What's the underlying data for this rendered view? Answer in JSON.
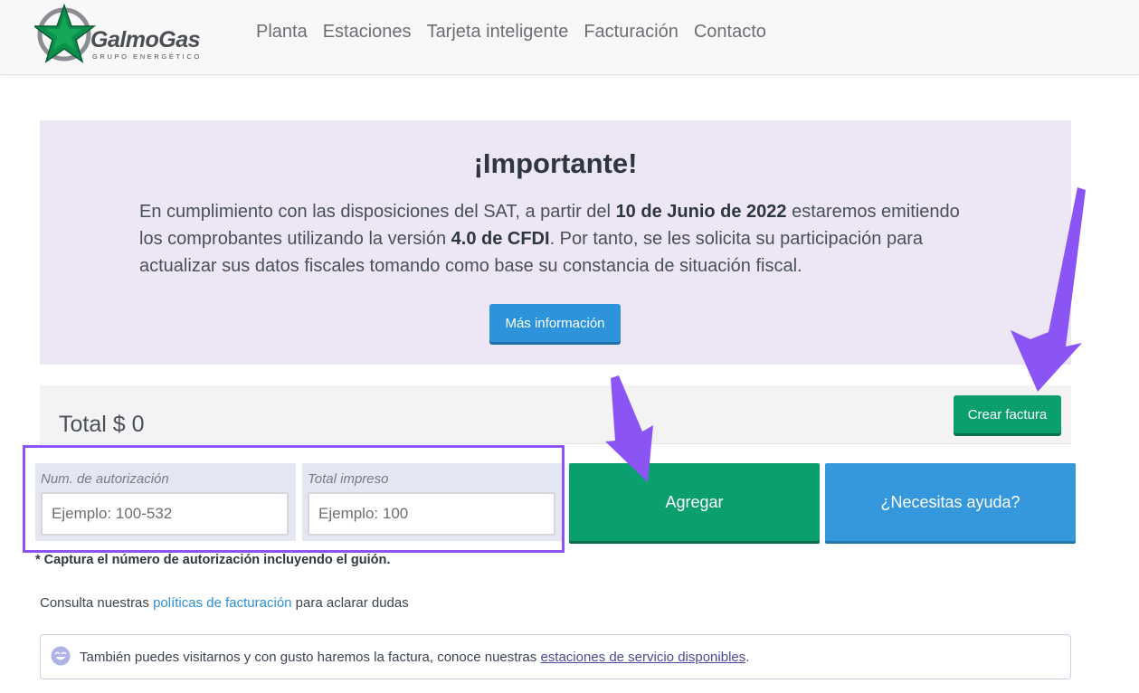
{
  "brand": {
    "name": "GalmoGas",
    "tagline": "GRUPO ENERGÉTICO",
    "colors": {
      "star": "#0c8f4b",
      "text": "#4a4e52"
    }
  },
  "nav": {
    "items": [
      "Planta",
      "Estaciones",
      "Tarjeta inteligente",
      "Facturación",
      "Contacto"
    ]
  },
  "notice": {
    "title": "¡Importante!",
    "text_1": "En cumplimiento con las disposiciones del SAT, a partir del ",
    "date": "10 de Junio de 2022",
    "text_2": " estaremos emitiendo los comprobantes utilizando la versión ",
    "version": "4.0 de CFDI",
    "text_3": ". Por tanto, se les solicita su participación para actualizar sus datos fiscales tomando como base su constancia de situación fiscal.",
    "button_label": "Más información",
    "background": "#ece6f5"
  },
  "invoice": {
    "total_label": "Total $ 0",
    "create_button": "Crear factura"
  },
  "form": {
    "auth_label": "Num. de autorización",
    "auth_placeholder": "Ejemplo: 100-532",
    "total_label": "Total impreso",
    "total_placeholder": "Ejemplo: 100",
    "add_button": "Agregar",
    "help_button": "¿Necesitas ayuda?",
    "note": "* Captura el número de autorización incluyendo el guión."
  },
  "policies": {
    "prefix": "Consulta nuestras ",
    "link": "políticas de facturación",
    "suffix": " para aclarar dudas"
  },
  "visit": {
    "icon": "smile-icon",
    "text": "También puedes visitarnos y con gusto haremos la factura, conoce nuestras ",
    "link": "estaciones de servicio disponibles",
    "end": "."
  },
  "annotations": {
    "highlight_color": "#8b55f5"
  },
  "colors": {
    "primary_green": "#0b9e6f",
    "primary_blue": "#3598dc"
  }
}
